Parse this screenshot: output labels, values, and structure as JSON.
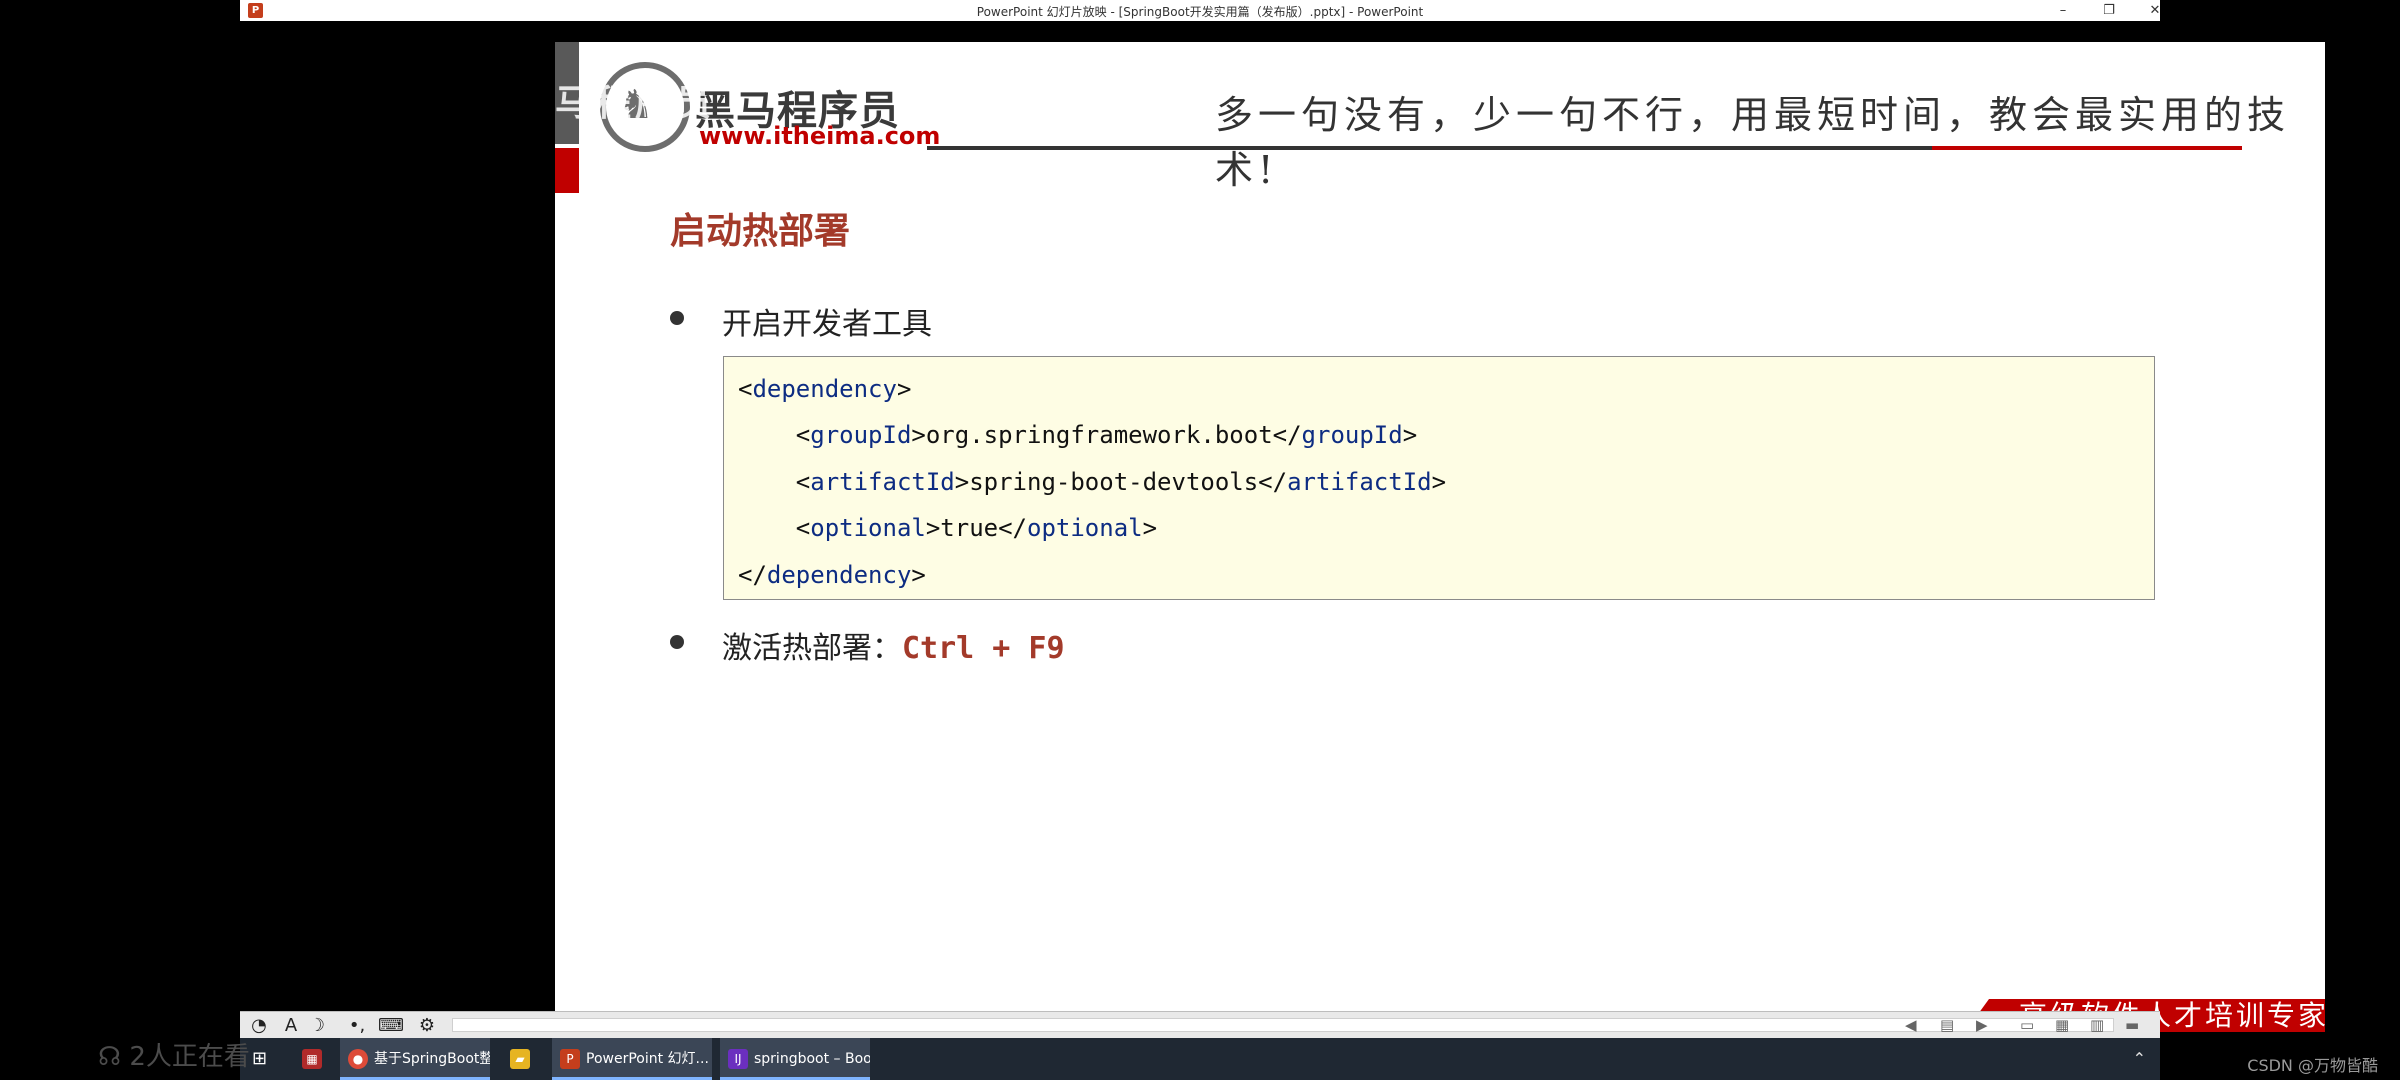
{
  "window": {
    "title": "PowerPoint 幻灯片放映 - [SpringBoot开发实用篇（发布版）.pptx] - PowerPoint",
    "app_icon": "P",
    "minimize": "–",
    "restore": "❐",
    "close": "✕"
  },
  "slide": {
    "watermark": "黑马程序员",
    "logo_name": "黑马程序员",
    "logo_url": "www.itheima.com",
    "slogan": "多一句没有，少一句不行，用最短时间，教会最实用的技术!",
    "title": "启动热部署",
    "bullet1": "开启开发者工具",
    "code": {
      "line1_open": "<",
      "line1_tag": "dependency",
      "line1_close": ">",
      "line2_indent": "    <",
      "line2_tag": "groupId",
      "line2_mid": ">org.springframework.boot</",
      "line2_tag_end": "groupId",
      "line2_close": ">",
      "line3_indent": "    <",
      "line3_tag": "artifactId",
      "line3_mid": ">spring-boot-devtools</",
      "line3_tag_end": "artifactId",
      "line3_close": ">",
      "line4_indent": "    <",
      "line4_tag": "optional",
      "line4_mid": ">true</",
      "line4_tag_end": "optional",
      "line4_close": ">",
      "line5_open": "</",
      "line5_tag": "dependency",
      "line5_close": ">"
    },
    "bullet2_prefix": "激活热部署：",
    "bullet2_keys": "Ctrl + F9",
    "footer": "高级软件人才培训专家"
  },
  "toolbar": {
    "pointer_icon": "pointer-icon",
    "pen_label": "A",
    "highlighter": "☽",
    "more": "•,",
    "keyboard": "⌨",
    "settings": "⚙",
    "nav_prev": "◀",
    "nav_menu": "▤",
    "nav_next": "▶",
    "view_normal": "▭",
    "view_sorter": "▦",
    "view_reading": "▥",
    "view_show": "▬"
  },
  "taskbar": {
    "items": [
      {
        "label": "",
        "icon": "▦"
      },
      {
        "label": "基于SpringBoot整...",
        "icon": "●"
      },
      {
        "label": "",
        "icon": "▰"
      },
      {
        "label": "PowerPoint 幻灯...",
        "icon": "P"
      },
      {
        "label": "springboot – Boo...",
        "icon": "IJ"
      }
    ],
    "tray": "⌃"
  },
  "overlay": {
    "viewers": "2人正在看",
    "csdn": "CSDN @万物皆酷"
  },
  "colors": {
    "accent_red": "#c00000",
    "title_red": "#a33a2a",
    "code_bg": "#fefde4",
    "tag_blue": "#0d2c82"
  }
}
